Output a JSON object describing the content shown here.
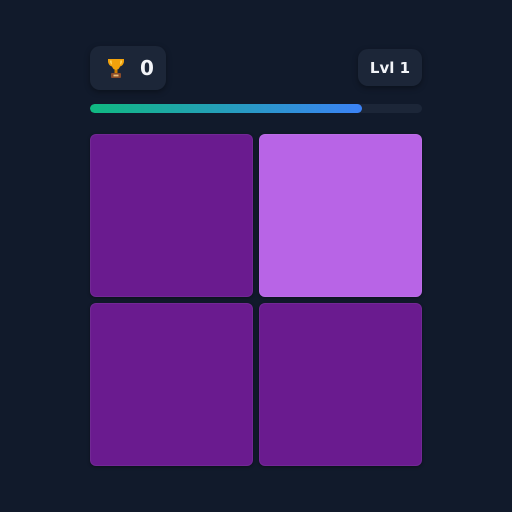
{
  "hud": {
    "trophy_icon": "trophy-icon",
    "score": "0",
    "level": "Lvl 1"
  },
  "progress": {
    "fraction": 0.82,
    "colors": [
      "#10b981",
      "#3b82f6"
    ]
  },
  "board": {
    "tiles": [
      {
        "color": "#6a1b8f",
        "state": "normal"
      },
      {
        "color": "#b864e6",
        "state": "odd"
      },
      {
        "color": "#6a1b8f",
        "state": "normal"
      },
      {
        "color": "#6a1b8f",
        "state": "normal"
      }
    ]
  }
}
